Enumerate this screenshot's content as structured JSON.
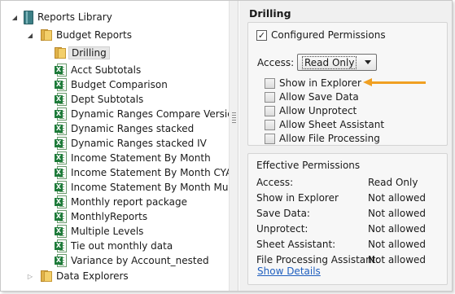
{
  "tree": {
    "root": {
      "label": "Reports Library",
      "icon": "library-icon",
      "expanded": true
    },
    "budget_reports": {
      "label": "Budget Reports",
      "icon": "folder-icon",
      "expanded": true
    },
    "drilling": {
      "label": "Drilling",
      "icon": "folder-icon",
      "selected": true
    },
    "reports": [
      {
        "label": "Acct Subtotals"
      },
      {
        "label": "Budget Comparison"
      },
      {
        "label": "Dept Subtotals"
      },
      {
        "label": "Dynamic Ranges Compare Versions"
      },
      {
        "label": "Dynamic Ranges stacked"
      },
      {
        "label": "Dynamic Ranges stacked IV"
      },
      {
        "label": "Income Statement By Month"
      },
      {
        "label": "Income Statement By Month CYA"
      },
      {
        "label": "Income Statement By Month Multip"
      },
      {
        "label": "Monthly report package"
      },
      {
        "label": "MonthlyReports"
      },
      {
        "label": "Multiple Levels"
      },
      {
        "label": "Tie out monthly data"
      },
      {
        "label": "Variance by Account_nested"
      }
    ],
    "data_explorers": {
      "label": "Data Explorers",
      "icon": "folder-icon",
      "expanded": false
    },
    "report_icon_badge": "X"
  },
  "details": {
    "title": "Drilling",
    "configured_permissions": {
      "label": "Configured Permissions",
      "checked": true
    },
    "access_label": "Access:",
    "access_value": "Read Only",
    "permissions": [
      {
        "label": "Show in Explorer",
        "checked": false
      },
      {
        "label": "Allow Save Data",
        "checked": false
      },
      {
        "label": "Allow Unprotect",
        "checked": false
      },
      {
        "label": "Allow Sheet Assistant",
        "checked": false
      },
      {
        "label": "Allow File Processing",
        "checked": false
      }
    ],
    "effective": {
      "title": "Effective Permissions",
      "rows": [
        {
          "label": "Access:",
          "value": "Read Only"
        },
        {
          "label": "Show in Explorer",
          "value": "Not allowed"
        },
        {
          "label": "Save Data:",
          "value": "Not allowed"
        },
        {
          "label": "Unprotect:",
          "value": "Not allowed"
        },
        {
          "label": "Sheet Assistant:",
          "value": "Not allowed"
        },
        {
          "label": "File Processing Assistant:",
          "value": "Not allowed"
        }
      ],
      "show_details": "Show Details"
    }
  },
  "colors": {
    "annotation_arrow": "#f0a022",
    "link": "#1f5fbf",
    "excel_badge": "#1e7b3a",
    "folder": "#f3cf6a"
  }
}
